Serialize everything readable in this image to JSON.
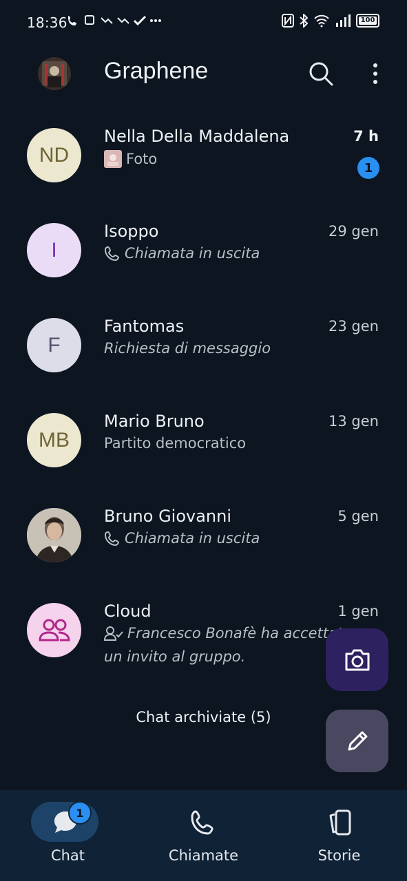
{
  "status_bar": {
    "time": "18:36",
    "battery": "100"
  },
  "header": {
    "title": "Graphene"
  },
  "chats": [
    {
      "initials": "ND",
      "name": "Nella Della Maddalena",
      "time": "7 h",
      "subtitle": "Foto",
      "unread": "1",
      "avatar_bg": "#ece7cf",
      "avatar_fg": "#6f6536"
    },
    {
      "initials": "I",
      "name": "Isoppo",
      "time": "29 gen",
      "subtitle": "Chiamata in uscita",
      "avatar_bg": "#eadcf7",
      "avatar_fg": "#7a34b8"
    },
    {
      "initials": "F",
      "name": "Fantomas",
      "time": "23 gen",
      "subtitle": "Richiesta di messaggio",
      "avatar_bg": "#dcdde8",
      "avatar_fg": "#4f526e"
    },
    {
      "initials": "MB",
      "name": "Mario Bruno",
      "time": "13 gen",
      "subtitle": "Partito democratico",
      "avatar_bg": "#ece7cf",
      "avatar_fg": "#6f6536"
    },
    {
      "initials": "",
      "name": "Bruno Giovanni",
      "time": "5 gen",
      "subtitle": "Chiamata in uscita"
    },
    {
      "initials": "",
      "name": "Cloud",
      "time": "1 gen",
      "subtitle": "Francesco Bonafè ha accettato",
      "subtitle_line2": "un invito al gruppo.",
      "avatar_bg": "#f6d3ec",
      "avatar_fg": "#b1258a"
    }
  ],
  "archived": {
    "label": "Chat archiviate (5)"
  },
  "nav": {
    "chat_label": "Chat",
    "chat_badge": "1",
    "calls_label": "Chiamate",
    "stories_label": "Storie"
  },
  "colors": {
    "background": "#0c1520",
    "accent": "#2a8ff2",
    "nav_bg": "#0f2236"
  }
}
